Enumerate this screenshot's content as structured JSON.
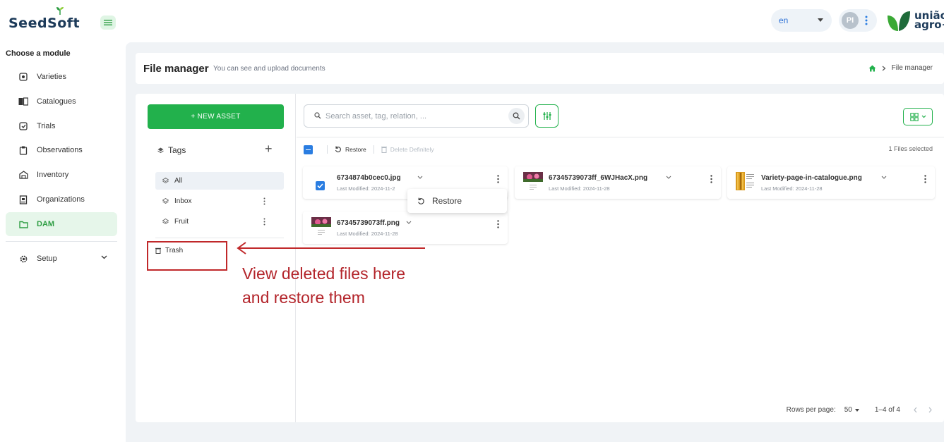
{
  "app": {
    "logo_text": "SeedSoft",
    "language": "en",
    "user_initials": "PI",
    "brand_line1": "união",
    "brand_line2": "agro+"
  },
  "sidebar": {
    "module_title": "Choose a module",
    "items": [
      {
        "label": "Varieties",
        "icon": "seed-icon"
      },
      {
        "label": "Catalogues",
        "icon": "book-icon"
      },
      {
        "label": "Trials",
        "icon": "trial-icon"
      },
      {
        "label": "Observations",
        "icon": "clipboard-icon"
      },
      {
        "label": "Inventory",
        "icon": "warehouse-icon"
      },
      {
        "label": "Organizations",
        "icon": "building-icon"
      },
      {
        "label": "DAM",
        "icon": "folder-icon",
        "active": true
      }
    ],
    "setup_label": "Setup"
  },
  "header": {
    "title": "File manager",
    "subtitle": "You can see and upload documents",
    "breadcrumb": "File manager"
  },
  "left_panel": {
    "new_asset_label": "+ NEW ASSET",
    "tags_label": "Tags",
    "tags": [
      {
        "label": "All",
        "selected": true
      },
      {
        "label": "Inbox"
      },
      {
        "label": "Fruit"
      }
    ],
    "trash_label": "Trash"
  },
  "search": {
    "placeholder": "Search asset, tag, relation, ..."
  },
  "toolbar": {
    "restore_label": "Restore",
    "delete_label": "Delete Definitely",
    "selected_text": "1 Files selected"
  },
  "files": [
    {
      "name": "6734874b0cec0.jpg",
      "modified": "Last Modified: 2024-11-2",
      "checked": true
    },
    {
      "name": "67345739073ff_6WJHacX.png",
      "modified": "Last Modified: 2024-11-28"
    },
    {
      "name": "Variety-page-in-catalogue.png",
      "modified": "Last Modified: 2024-11-28"
    },
    {
      "name": "67345739073ff.png",
      "modified": "Last Modified: 2024-11-28"
    }
  ],
  "popover": {
    "restore_label": "Restore"
  },
  "pagination": {
    "rows_label": "Rows per page:",
    "rows_value": "50",
    "range": "1–4 of 4"
  },
  "annotation": {
    "line1": "View deleted files here",
    "line2": "and restore them"
  },
  "colors": {
    "accent_green": "#22b14c",
    "annotation_red": "#c0282a",
    "checkbox_blue": "#2a7de1"
  }
}
